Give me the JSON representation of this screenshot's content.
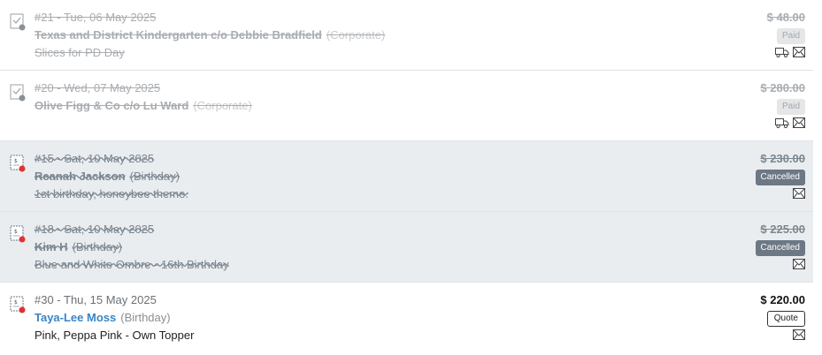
{
  "orders": [
    {
      "header": "#21 - Tue, 06 May 2025",
      "customer": "Texas and District Kindergarten c/o Debbie Bradfield",
      "type": "(Corporate)",
      "description": "Slices for PD Day",
      "amount": "$ 48.00",
      "status": "Paid",
      "icons": [
        "delivery-truck-icon",
        "envelope-icon"
      ]
    },
    {
      "header": "#20 - Wed, 07 May 2025",
      "customer": "Olive Figg & Co c/o Lu Ward",
      "type": "(Corporate)",
      "description": "",
      "amount": "$ 280.00",
      "status": "Paid",
      "icons": [
        "delivery-truck-icon",
        "envelope-icon"
      ]
    },
    {
      "header": "#15 - Sat, 10 May 2025",
      "customer": "Reanah Jackson",
      "type": "(Birthday)",
      "description": "1st birthday, honeybee theme.",
      "amount": "$ 230.00",
      "status": "Cancelled",
      "icons": [
        "envelope-icon"
      ]
    },
    {
      "header": "#18 - Sat, 10 May 2025",
      "customer": "Kim H",
      "type": "(Birthday)",
      "description": "Blue and White Ombre - 16th Birthday",
      "amount": "$ 225.00",
      "status": "Cancelled",
      "icons": [
        "envelope-icon"
      ]
    },
    {
      "header": "#30 - Thu, 15 May 2025",
      "customer": "Taya-Lee Moss",
      "type": "(Birthday)",
      "description": "Pink, Peppa Pink - Own Topper",
      "amount": "$ 220.00",
      "status": "Quote",
      "icons": [
        "envelope-icon"
      ]
    }
  ],
  "colors": {
    "link": "#3a85c6",
    "cancelled_bg": "#eaedf0",
    "cancelled_badge": "#6c7884",
    "status_dot_grey": "#8a9199",
    "status_dot_red": "#e03131"
  }
}
